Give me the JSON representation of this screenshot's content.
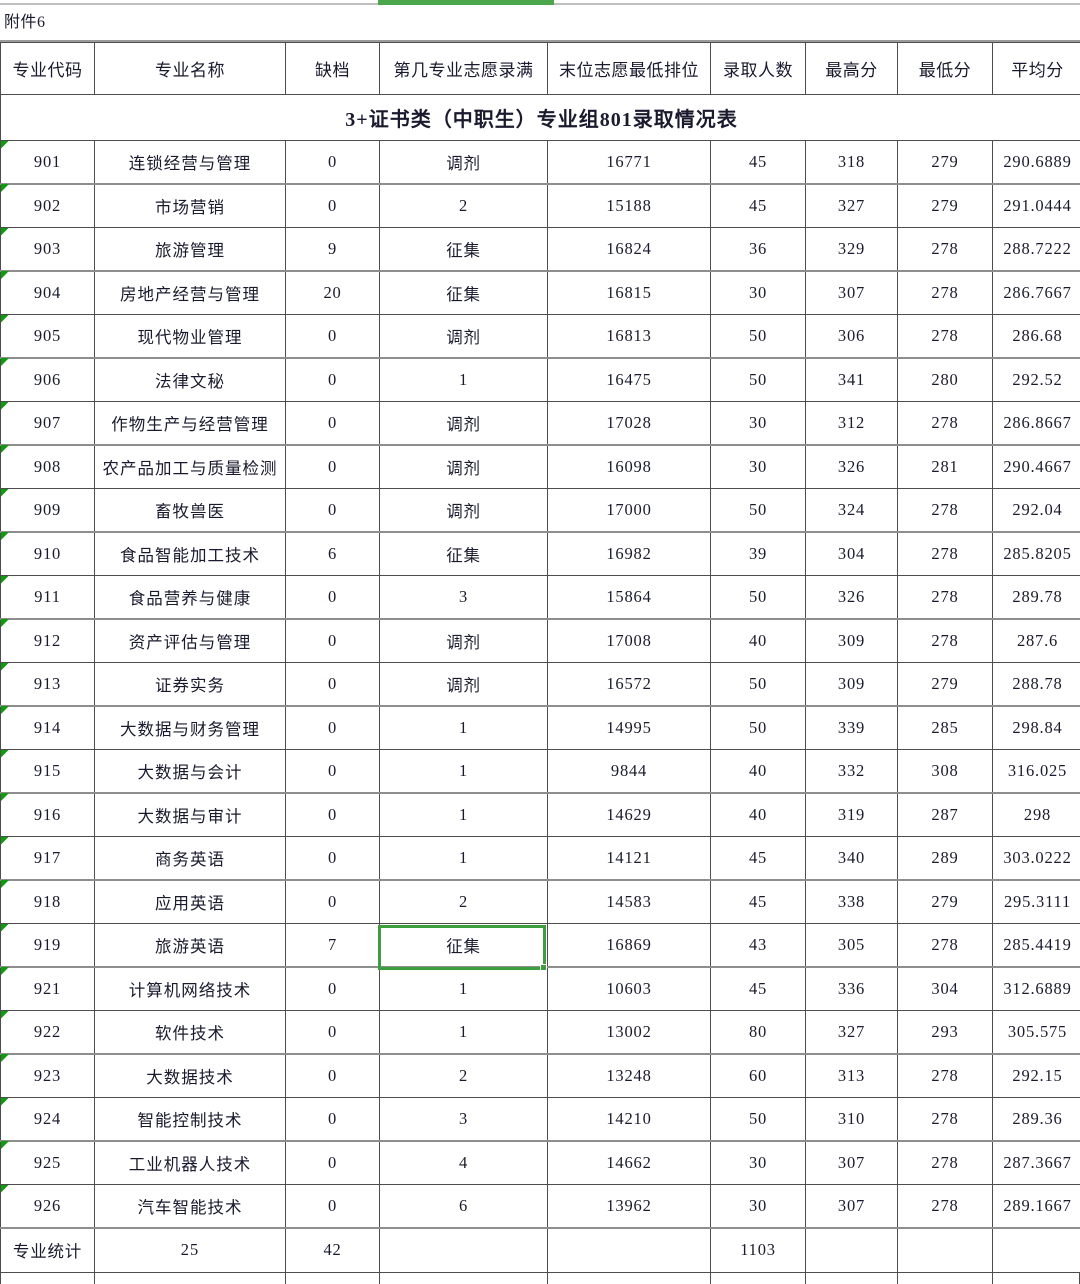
{
  "attachment": {
    "label": "附件6"
  },
  "title": "3+证书类（中职生）专业组801录取情况表",
  "columns": [
    "专业代码",
    "专业名称",
    "缺档",
    "第几专业志愿录满",
    "末位志愿最低排位",
    "录取人数",
    "最高分",
    "最低分",
    "平均分"
  ],
  "rows": [
    {
      "code": "901",
      "name": "连锁经营与管理",
      "shortage": "0",
      "fill_order": "调剂",
      "last_rank": "16771",
      "admitted": "45",
      "max": "318",
      "min": "279",
      "avg": "290.6889"
    },
    {
      "code": "902",
      "name": "市场营销",
      "shortage": "0",
      "fill_order": "2",
      "last_rank": "15188",
      "admitted": "45",
      "max": "327",
      "min": "279",
      "avg": "291.0444"
    },
    {
      "code": "903",
      "name": "旅游管理",
      "shortage": "9",
      "fill_order": "征集",
      "last_rank": "16824",
      "admitted": "36",
      "max": "329",
      "min": "278",
      "avg": "288.7222"
    },
    {
      "code": "904",
      "name": "房地产经营与管理",
      "shortage": "20",
      "fill_order": "征集",
      "last_rank": "16815",
      "admitted": "30",
      "max": "307",
      "min": "278",
      "avg": "286.7667"
    },
    {
      "code": "905",
      "name": "现代物业管理",
      "shortage": "0",
      "fill_order": "调剂",
      "last_rank": "16813",
      "admitted": "50",
      "max": "306",
      "min": "278",
      "avg": "286.68"
    },
    {
      "code": "906",
      "name": "法律文秘",
      "shortage": "0",
      "fill_order": "1",
      "last_rank": "16475",
      "admitted": "50",
      "max": "341",
      "min": "280",
      "avg": "292.52"
    },
    {
      "code": "907",
      "name": "作物生产与经营管理",
      "shortage": "0",
      "fill_order": "调剂",
      "last_rank": "17028",
      "admitted": "30",
      "max": "312",
      "min": "278",
      "avg": "286.8667"
    },
    {
      "code": "908",
      "name": "农产品加工与质量检测",
      "shortage": "0",
      "fill_order": "调剂",
      "last_rank": "16098",
      "admitted": "30",
      "max": "326",
      "min": "281",
      "avg": "290.4667"
    },
    {
      "code": "909",
      "name": "畜牧兽医",
      "shortage": "0",
      "fill_order": "调剂",
      "last_rank": "17000",
      "admitted": "50",
      "max": "324",
      "min": "278",
      "avg": "292.04"
    },
    {
      "code": "910",
      "name": "食品智能加工技术",
      "shortage": "6",
      "fill_order": "征集",
      "last_rank": "16982",
      "admitted": "39",
      "max": "304",
      "min": "278",
      "avg": "285.8205"
    },
    {
      "code": "911",
      "name": "食品营养与健康",
      "shortage": "0",
      "fill_order": "3",
      "last_rank": "15864",
      "admitted": "50",
      "max": "326",
      "min": "278",
      "avg": "289.78"
    },
    {
      "code": "912",
      "name": "资产评估与管理",
      "shortage": "0",
      "fill_order": "调剂",
      "last_rank": "17008",
      "admitted": "40",
      "max": "309",
      "min": "278",
      "avg": "287.6"
    },
    {
      "code": "913",
      "name": "证券实务",
      "shortage": "0",
      "fill_order": "调剂",
      "last_rank": "16572",
      "admitted": "50",
      "max": "309",
      "min": "279",
      "avg": "288.78"
    },
    {
      "code": "914",
      "name": "大数据与财务管理",
      "shortage": "0",
      "fill_order": "1",
      "last_rank": "14995",
      "admitted": "50",
      "max": "339",
      "min": "285",
      "avg": "298.84"
    },
    {
      "code": "915",
      "name": "大数据与会计",
      "shortage": "0",
      "fill_order": "1",
      "last_rank": "9844",
      "admitted": "40",
      "max": "332",
      "min": "308",
      "avg": "316.025"
    },
    {
      "code": "916",
      "name": "大数据与审计",
      "shortage": "0",
      "fill_order": "1",
      "last_rank": "14629",
      "admitted": "40",
      "max": "319",
      "min": "287",
      "avg": "298"
    },
    {
      "code": "917",
      "name": "商务英语",
      "shortage": "0",
      "fill_order": "1",
      "last_rank": "14121",
      "admitted": "45",
      "max": "340",
      "min": "289",
      "avg": "303.0222"
    },
    {
      "code": "918",
      "name": "应用英语",
      "shortage": "0",
      "fill_order": "2",
      "last_rank": "14583",
      "admitted": "45",
      "max": "338",
      "min": "279",
      "avg": "295.3111"
    },
    {
      "code": "919",
      "name": "旅游英语",
      "shortage": "7",
      "fill_order": "征集",
      "last_rank": "16869",
      "admitted": "43",
      "max": "305",
      "min": "278",
      "avg": "285.4419"
    },
    {
      "code": "921",
      "name": "计算机网络技术",
      "shortage": "0",
      "fill_order": "1",
      "last_rank": "10603",
      "admitted": "45",
      "max": "336",
      "min": "304",
      "avg": "312.6889"
    },
    {
      "code": "922",
      "name": "软件技术",
      "shortage": "0",
      "fill_order": "1",
      "last_rank": "13002",
      "admitted": "80",
      "max": "327",
      "min": "293",
      "avg": "305.575"
    },
    {
      "code": "923",
      "name": "大数据技术",
      "shortage": "0",
      "fill_order": "2",
      "last_rank": "13248",
      "admitted": "60",
      "max": "313",
      "min": "278",
      "avg": "292.15"
    },
    {
      "code": "924",
      "name": "智能控制技术",
      "shortage": "0",
      "fill_order": "3",
      "last_rank": "14210",
      "admitted": "50",
      "max": "310",
      "min": "278",
      "avg": "289.36"
    },
    {
      "code": "925",
      "name": "工业机器人技术",
      "shortage": "0",
      "fill_order": "4",
      "last_rank": "14662",
      "admitted": "30",
      "max": "307",
      "min": "278",
      "avg": "287.3667"
    },
    {
      "code": "926",
      "name": "汽车智能技术",
      "shortage": "0",
      "fill_order": "6",
      "last_rank": "13962",
      "admitted": "30",
      "max": "307",
      "min": "278",
      "avg": "289.1667"
    }
  ],
  "total_row": {
    "code": "专业统计",
    "name": "25",
    "shortage": "42",
    "fill_order": "",
    "last_rank": "",
    "admitted": "1103",
    "max": "",
    "min": "",
    "avg": ""
  },
  "selection": {
    "active_cell_value": "征集",
    "row_code": "919",
    "column": "第几专业志愿录满"
  },
  "watermark": {
    "text": ""
  },
  "colors": {
    "selection_green": "#3c9e3c",
    "top_bar_green": "#4ca64c",
    "marker_green": "#119911",
    "grid_dark": "#4d4d4d",
    "grid_light": "#8e8e8e",
    "text": "#1a1a2e"
  }
}
